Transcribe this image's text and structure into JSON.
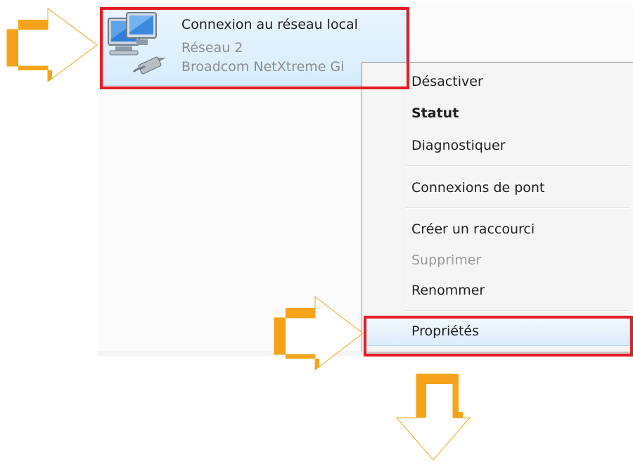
{
  "connection": {
    "name": "Connexion au réseau local",
    "network": "Réseau  2",
    "adapter": "Broadcom NetXtreme Gi",
    "icon": "network-adapter-icon",
    "selected": true
  },
  "context_menu": {
    "items": [
      {
        "label": "Désactiver",
        "enabled": true,
        "bold": false
      },
      {
        "label": "Statut",
        "enabled": true,
        "bold": true
      },
      {
        "label": "Diagnostiquer",
        "enabled": true,
        "bold": false
      },
      {
        "label": "Connexions de pont",
        "enabled": true,
        "bold": false
      },
      {
        "label": "Créer un raccourci",
        "enabled": true,
        "bold": false
      },
      {
        "label": "Supprimer",
        "enabled": false,
        "bold": false
      },
      {
        "label": "Renommer",
        "enabled": true,
        "bold": false
      },
      {
        "label": "Propriétés",
        "enabled": true,
        "bold": false,
        "highlighted": true
      }
    ]
  },
  "annotations": {
    "highlight_color": "#e51c23",
    "arrow_color": "#f5a31a",
    "arrow_icons": [
      "arrow-right-icon",
      "arrow-right-icon",
      "arrow-down-icon"
    ]
  }
}
